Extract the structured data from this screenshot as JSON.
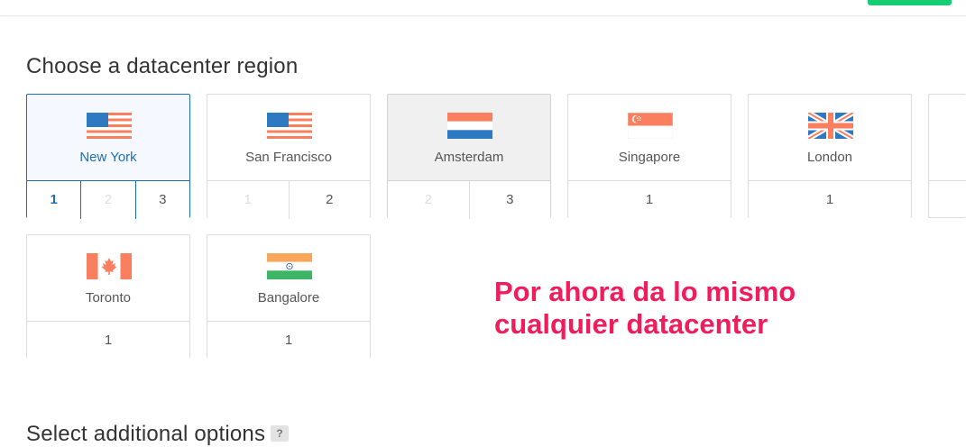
{
  "section_title": "Choose a datacenter region",
  "section2_title": "Select additional options",
  "help_badge": "?",
  "annotation": [
    "Por ahora da lo mismo",
    "cualquier datacenter"
  ],
  "colors": {
    "selected": "#1a6fb5",
    "annotation": "#f01c5c",
    "top_button": "#15cd72"
  },
  "regions": [
    {
      "name": "New York",
      "flag": "us-flag-icon",
      "state": "selected",
      "numbers": [
        {
          "label": "1",
          "state": "current"
        },
        {
          "label": "2",
          "state": "disabled"
        },
        {
          "label": "3",
          "state": "normal"
        }
      ]
    },
    {
      "name": "San Francisco",
      "flag": "us-flag-icon",
      "state": "normal",
      "numbers": [
        {
          "label": "1",
          "state": "disabled"
        },
        {
          "label": "2",
          "state": "normal"
        }
      ]
    },
    {
      "name": "Amsterdam",
      "flag": "nl-flag-icon",
      "state": "active",
      "numbers": [
        {
          "label": "2",
          "state": "disabled"
        },
        {
          "label": "3",
          "state": "normal"
        }
      ]
    },
    {
      "name": "Singapore",
      "flag": "sg-flag-icon",
      "state": "normal",
      "numbers": [
        {
          "label": "1",
          "state": "normal"
        }
      ]
    },
    {
      "name": "London",
      "flag": "uk-flag-icon",
      "state": "normal",
      "numbers": [
        {
          "label": "1",
          "state": "normal"
        }
      ]
    },
    {
      "name": "Toronto",
      "flag": "ca-flag-icon",
      "state": "normal",
      "numbers": [
        {
          "label": "1",
          "state": "normal"
        }
      ]
    },
    {
      "name": "Bangalore",
      "flag": "in-flag-icon",
      "state": "normal",
      "numbers": [
        {
          "label": "1",
          "state": "normal"
        }
      ]
    }
  ]
}
